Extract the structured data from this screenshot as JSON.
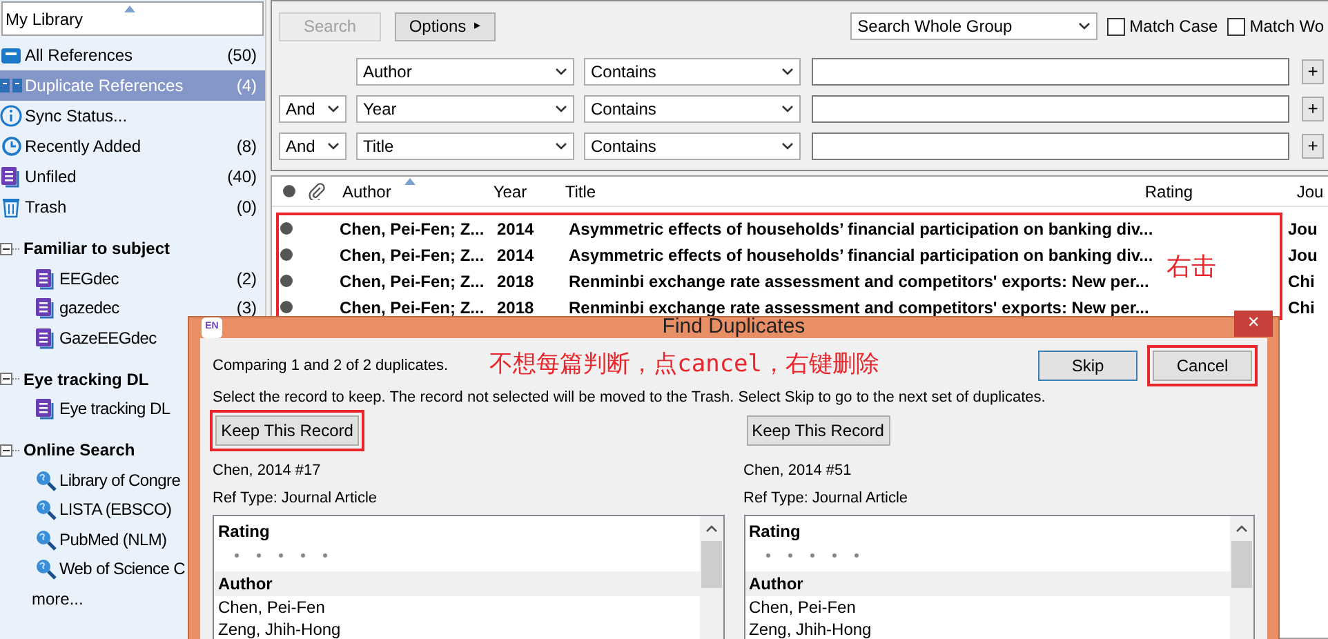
{
  "sidebar": {
    "header": "My Library",
    "items": [
      {
        "kind": "all",
        "label": "All References",
        "count": "(50)",
        "selected": false
      },
      {
        "kind": "duplicate",
        "label": "Duplicate References",
        "count": "(4)",
        "selected": true
      },
      {
        "kind": "sync",
        "label": "Sync Status...",
        "selected": false
      },
      {
        "kind": "recent",
        "label": "Recently Added",
        "count": "(8)",
        "selected": false
      },
      {
        "kind": "group",
        "label": "Unfiled",
        "count": "(40)",
        "selected": false
      },
      {
        "kind": "trash",
        "label": "Trash",
        "count": "(0)",
        "selected": false
      }
    ],
    "group_sets": [
      {
        "label": "Familiar to subject",
        "expanded": true,
        "children": [
          {
            "kind": "group",
            "label": "EEGdec",
            "count": "(2)"
          },
          {
            "kind": "group",
            "label": "gazedec",
            "count": "(3)"
          },
          {
            "kind": "group",
            "label": "GazeEEGdec"
          }
        ]
      },
      {
        "label": "Eye tracking DL",
        "expanded": true,
        "children": [
          {
            "kind": "group",
            "label": "Eye tracking DL"
          }
        ]
      },
      {
        "label": "Online Search",
        "expanded": true,
        "children": [
          {
            "kind": "online",
            "label": "Library of Congre"
          },
          {
            "kind": "online",
            "label": "LISTA (EBSCO)"
          },
          {
            "kind": "online",
            "label": "PubMed (NLM)"
          },
          {
            "kind": "online",
            "label": "Web of Science C"
          }
        ],
        "more": "more..."
      }
    ]
  },
  "search": {
    "search_button": {
      "label": "Search",
      "disabled": true
    },
    "options_button": "Options",
    "options_arrow": "▸",
    "scope": "Search Whole Group",
    "checkboxes": [
      {
        "label": "Match Case",
        "checked": false
      },
      {
        "label": "Match Wo",
        "checked": false
      }
    ],
    "criteria": [
      {
        "field": "Author",
        "operator": "Contains",
        "add": "+"
      },
      {
        "connector": "And",
        "field": "Year",
        "operator": "Contains",
        "add": "+"
      },
      {
        "connector": "And",
        "field": "Title",
        "operator": "Contains",
        "add": "+"
      }
    ]
  },
  "table": {
    "columns": [
      "Author",
      "Year",
      "Title",
      "Rating",
      "Jou"
    ],
    "highlighted": true,
    "rows": [
      {
        "author": "Chen, Pei-Fen; Z...",
        "year": "2014",
        "title": "Asymmetric effects of households’ financial participation on banking div...",
        "journal": "Jou",
        "unread": true
      },
      {
        "author": "Chen, Pei-Fen; Z...",
        "year": "2014",
        "title": "Asymmetric effects of households’ financial participation on banking div...",
        "journal": "Jou",
        "unread": true
      },
      {
        "author": "Chen, Pei-Fen; Z...",
        "year": "2018",
        "title": "Renminbi exchange rate assessment and competitors' exports: New per...",
        "journal": "Chi",
        "unread": true
      },
      {
        "author": "Chen, Pei-Fen; Z...",
        "year": "2018",
        "title": "Renminbi exchange rate assessment and competitors' exports: New per...",
        "journal": "Chi",
        "unread": true
      }
    ],
    "annotation": "右击"
  },
  "dialog": {
    "app_badge": "EN",
    "title": "Find Duplicates",
    "close": "✕",
    "status": "Comparing 1 and 2 of 2 duplicates.",
    "annotation": "不想每篇判断，点cancel，右键删除",
    "instructions": "Select the record to keep. The record not selected will be moved to the Trash. Select Skip to go to the next set of duplicates.",
    "buttons": [
      {
        "label": "Skip",
        "highlighted": false,
        "default": true
      },
      {
        "label": "Cancel",
        "highlighted": true,
        "default": false
      }
    ],
    "records": [
      {
        "keep_button": "Keep This Record",
        "highlighted": true,
        "citation": "Chen, 2014 #17",
        "ref_type": "Ref Type: Journal Article",
        "rating_label": "Rating",
        "author_label": "Author",
        "authors": [
          "Chen, Pei-Fen",
          "Zeng, Jhih-Hong"
        ]
      },
      {
        "keep_button": "Keep This Record",
        "highlighted": false,
        "citation": "Chen, 2014 #51",
        "ref_type": "Ref Type: Journal Article",
        "rating_label": "Rating",
        "author_label": "Author",
        "authors": [
          "Chen, Pei-Fen",
          "Zeng, Jhih-Hong"
        ]
      }
    ]
  }
}
